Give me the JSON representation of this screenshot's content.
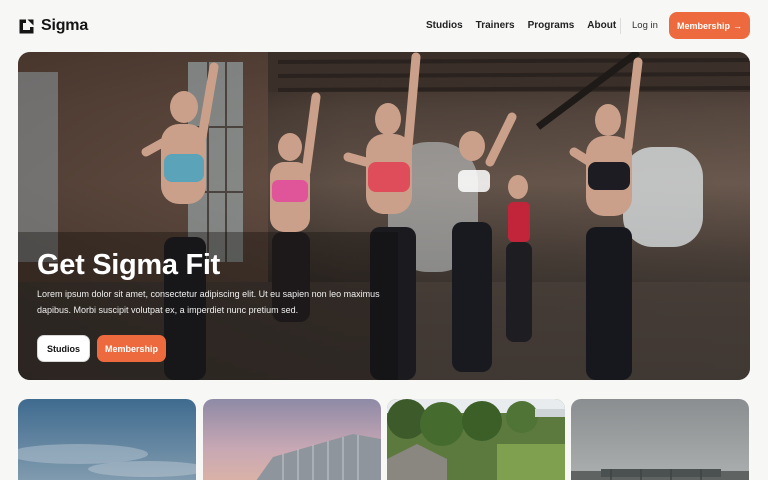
{
  "brand": {
    "name": "Sigma",
    "accent": "#ec6a3e"
  },
  "nav": {
    "items": [
      {
        "label": "Studios"
      },
      {
        "label": "Trainers"
      },
      {
        "label": "Programs"
      },
      {
        "label": "About"
      }
    ],
    "login_label": "Log in",
    "cta_label": "Membership",
    "cta_arrow": "→"
  },
  "hero": {
    "title": "Get Sigma Fit",
    "description": "Lorem ipsum dolor sit amet, consectetur adipiscing elit. Ut eu sapien non leo maximus dapibus. Morbi suscipit volutpat ex, a imperdiet nunc pretium sed.",
    "primary_button": "Studios",
    "secondary_button": "Membership"
  },
  "cards": [
    {
      "subject": "sky-photo"
    },
    {
      "subject": "building-photo"
    },
    {
      "subject": "forest-photo"
    },
    {
      "subject": "overcast-photo"
    }
  ]
}
